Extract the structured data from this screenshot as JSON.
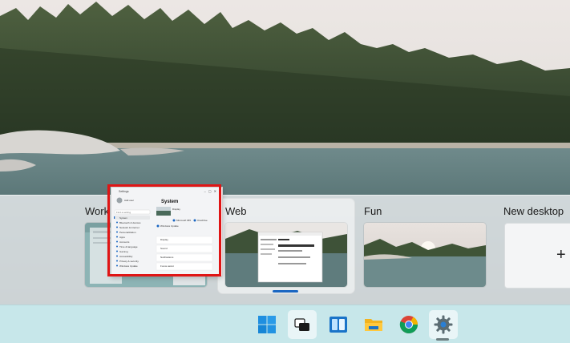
{
  "desktops": [
    {
      "label": "Work"
    },
    {
      "label": "Web"
    },
    {
      "label": "Fun"
    },
    {
      "label": "New desktop"
    }
  ],
  "new_desktop_plus": "+",
  "settings_window": {
    "title": "Settings",
    "heading": "System",
    "user_name": "Add user",
    "search_placeholder": "Find a setting",
    "sidebar": [
      "System",
      "Bluetooth & devices",
      "Network & internet",
      "Personalization",
      "Apps",
      "Accounts",
      "Time & language",
      "Gaming",
      "Accessibility",
      "Privacy & security",
      "Windows Update"
    ],
    "top_items": [
      {
        "label": "Display"
      },
      {
        "label": "Microsoft 365"
      },
      {
        "label": "OneDrive"
      },
      {
        "label": "Windows Update"
      }
    ],
    "list_items": [
      "Display",
      "Sound",
      "Notifications",
      "Focus assist"
    ]
  },
  "taskbar": {
    "items": [
      {
        "name": "start-button",
        "icon": "windows-logo-icon"
      },
      {
        "name": "task-view-button",
        "icon": "task-view-icon"
      },
      {
        "name": "widgets-button",
        "icon": "widgets-icon"
      },
      {
        "name": "file-explorer-button",
        "icon": "folder-icon"
      },
      {
        "name": "chrome-button",
        "icon": "chrome-icon"
      },
      {
        "name": "settings-button",
        "icon": "gear-icon"
      }
    ]
  },
  "colors": {
    "accent": "#1a66c2",
    "highlight": "#e01515",
    "taskbar": "#c7e7ea"
  }
}
